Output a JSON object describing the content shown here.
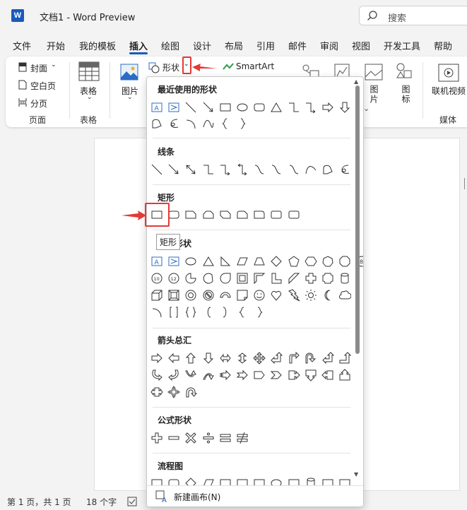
{
  "titlebar": {
    "logo_letter": "W",
    "title": "文档1  -  Word Preview",
    "search_placeholder": "搜索"
  },
  "menu": {
    "tabs": [
      "文件",
      "开始",
      "我的模板",
      "插入",
      "绘图",
      "设计",
      "布局",
      "引用",
      "邮件",
      "审阅",
      "视图",
      "开发工具",
      "帮助"
    ],
    "active": "插入"
  },
  "ribbon": {
    "pages_group": {
      "cover": "封面",
      "blank": "空白页",
      "page_break": "分页",
      "label": "页面"
    },
    "table_group": {
      "table": "表格",
      "label": "表格"
    },
    "image": "图片",
    "shapes_button": "形状",
    "smartart": "SmartArt",
    "picture2": "图片",
    "icon": "图标",
    "online_video": "联机视频",
    "media_label": "媒体"
  },
  "dropdown": {
    "sections": {
      "recent": "最近使用的形状",
      "lines": "线条",
      "rectangles": "矩形",
      "basic": "基本形状",
      "arrows": "箭头总汇",
      "equation": "公式形状",
      "flowchart": "流程图"
    },
    "new_canvas": "新建画布(N)"
  },
  "tooltip": "矩形",
  "statusbar": {
    "page": "第 1 页，共 1 页",
    "words": "18 个字"
  },
  "colors": {
    "accent": "#185abd",
    "annotation": "#e53935"
  }
}
